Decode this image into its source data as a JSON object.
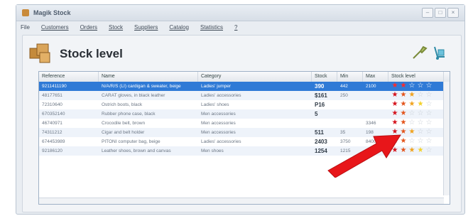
{
  "window": {
    "title": "Magik Stock",
    "controls": [
      "–",
      "□",
      "×"
    ]
  },
  "menu": [
    "File",
    "Customers",
    "Orders",
    "Stock",
    "Suppliers",
    "Catalog",
    "Statistics",
    "?"
  ],
  "page": {
    "title": "Stock level"
  },
  "columns": [
    "Reference",
    "Name",
    "Category",
    "Stock",
    "Min",
    "Max",
    "Stock level"
  ],
  "rows": [
    {
      "ref": "9211411190",
      "name": "N/A/R/S (LI) cardigan & sweater, beige",
      "cat": "Ladies' jumper",
      "stock": "390",
      "min": "442",
      "max": "2100",
      "level": 2
    },
    {
      "ref": "48177651",
      "name": "CARAT gloves, in black leather",
      "cat": "Ladies' accessories",
      "stock": "$161",
      "min": "250",
      "max": "",
      "level": 3
    },
    {
      "ref": "72310640",
      "name": "Ostrich boots, black",
      "cat": "Ladies' shoes",
      "stock": "P16",
      "min": "",
      "max": "",
      "level": 4
    },
    {
      "ref": "670352140",
      "name": "Rubber phone case, black",
      "cat": "Men accessories",
      "stock": "5",
      "min": "",
      "max": "",
      "level": 2
    },
    {
      "ref": "46740971",
      "name": "Crocodile belt, brown",
      "cat": "Men accessories",
      "stock": "",
      "min": "",
      "max": "3346",
      "level": 2
    },
    {
      "ref": "74311212",
      "name": "Cigar and belt holder",
      "cat": "Men accessories",
      "stock": "511",
      "min": "35",
      "max": "198",
      "level": 3
    },
    {
      "ref": "674453989",
      "name": "PITONI computer bag, beige",
      "cat": "Ladies' accessories",
      "stock": "2403",
      "min": "3750",
      "max": "8400",
      "level": 2
    },
    {
      "ref": "92186120",
      "name": "Leather shoes, brown and canvas",
      "cat": "Men shoes",
      "stock": "1254",
      "min": "1215",
      "max": "7408",
      "level": 4
    }
  ]
}
